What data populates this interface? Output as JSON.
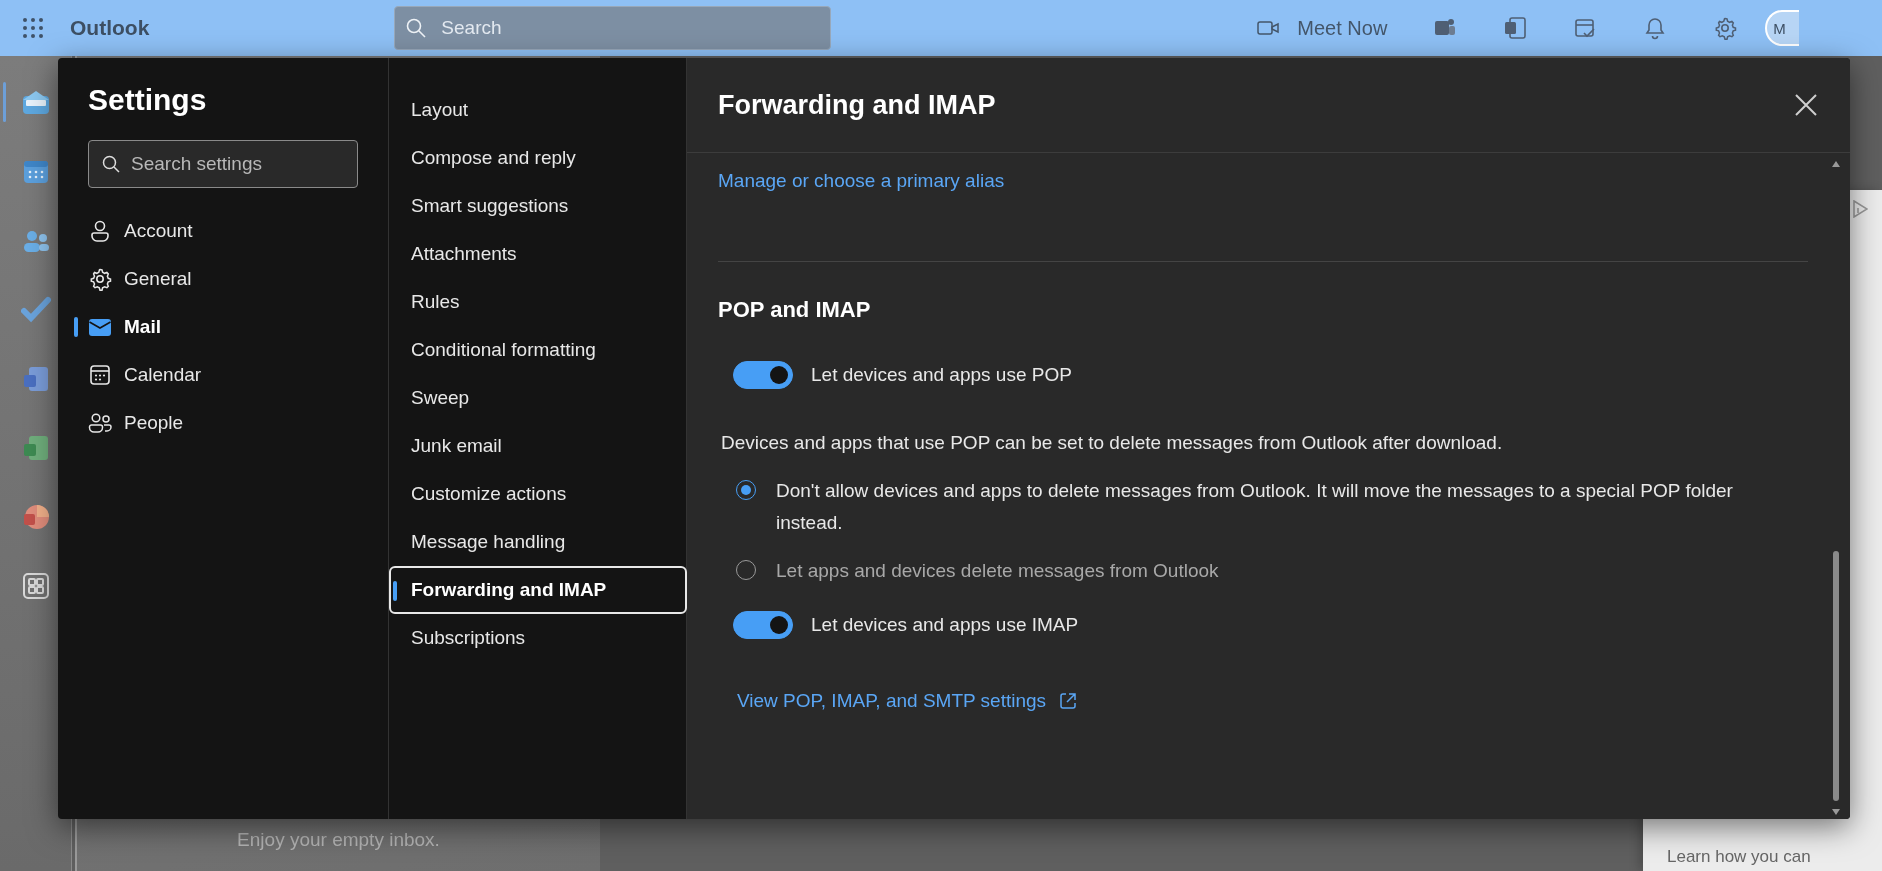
{
  "topbar": {
    "app_name": "Outlook",
    "search_placeholder": "Search",
    "meet_now": "Meet Now",
    "avatar": "M"
  },
  "rail": [
    {
      "selected": true
    },
    {
      "selected": false
    },
    {
      "selected": false
    },
    {
      "selected": false
    },
    {
      "selected": false
    },
    {
      "selected": false
    },
    {
      "selected": false
    },
    {
      "selected": false
    }
  ],
  "background": {
    "empty_inbox": "Enjoy your empty inbox.",
    "ad_text": "Learn how you can"
  },
  "settings": {
    "title": "Settings",
    "search_placeholder": "Search settings",
    "categories": [
      {
        "label": "Account",
        "selected": false
      },
      {
        "label": "General",
        "selected": false
      },
      {
        "label": "Mail",
        "selected": true
      },
      {
        "label": "Calendar",
        "selected": false
      },
      {
        "label": "People",
        "selected": false
      }
    ],
    "subcategories": [
      {
        "label": "Layout",
        "selected": false
      },
      {
        "label": "Compose and reply",
        "selected": false
      },
      {
        "label": "Smart suggestions",
        "selected": false
      },
      {
        "label": "Attachments",
        "selected": false
      },
      {
        "label": "Rules",
        "selected": false
      },
      {
        "label": "Conditional formatting",
        "selected": false
      },
      {
        "label": "Sweep",
        "selected": false
      },
      {
        "label": "Junk email",
        "selected": false
      },
      {
        "label": "Customize actions",
        "selected": false
      },
      {
        "label": "Message handling",
        "selected": false
      },
      {
        "label": "Forwarding and IMAP",
        "selected": true
      },
      {
        "label": "Subscriptions",
        "selected": false
      }
    ],
    "panel": {
      "title": "Forwarding and IMAP",
      "alias_link": "Manage or choose a primary alias",
      "section_title": "POP and IMAP",
      "options": [
        {
          "kind": "toggle",
          "label": "Let devices and apps use POP",
          "on": true
        },
        {
          "kind": "text",
          "label": "Devices and apps that use POP can be set to delete messages from Outlook after download."
        },
        {
          "kind": "radio",
          "label": "Don't allow devices and apps to delete messages from Outlook. It will move the messages to a special POP folder instead.",
          "selected": true
        },
        {
          "kind": "radio",
          "label": "Let apps and devices delete messages from Outlook",
          "selected": false
        },
        {
          "kind": "toggle",
          "label": "Let devices and apps use IMAP",
          "on": true
        }
      ],
      "settings_link": "View POP, IMAP, and SMTP settings"
    }
  }
}
